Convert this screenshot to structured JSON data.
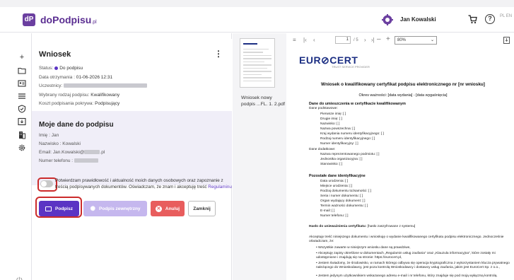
{
  "app": {
    "logo_mark": "dP",
    "logo_name": "doPodpisu",
    "logo_suffix": ".pl",
    "user_name": "Jan Kowalski",
    "lang": "PL EN"
  },
  "sidebar": {
    "icons": [
      "plus-icon",
      "folder-icon",
      "id-card-icon",
      "list-icon",
      "shield-icon",
      "inbox-icon",
      "building-icon",
      "gear-icon"
    ],
    "power_icon": "power-icon"
  },
  "request": {
    "title": "Wniosek",
    "status_label": "Status:",
    "status_value": "Do podpisu",
    "received_label": "Data otrzymania :",
    "received_value": "01-06-2026 12:31",
    "participants_label": "Uczestnicy:",
    "signature_type_label": "Wybrany rodzaj podpisu:",
    "signature_type_value": "Kwalifikowany",
    "cost_label": "Koszt podpisania pokrywa:",
    "cost_value": "Podpisujący"
  },
  "my_data": {
    "title": "Moje dane do podpisu",
    "first_name_label": "Imię :",
    "first_name_value": "Jan",
    "last_name_label": "Nazwisko :",
    "last_name_value": "Kowalski",
    "email_label": "Email:",
    "email_value_start": "Jan.Kowalski@",
    "email_value_end": ".pl",
    "phone_label": "Numer telefonu :"
  },
  "consent": {
    "text": "Potwierdzam prawidłowość i aktualność moich danych osobowych oraz zapoznanie z treścią podpisywanych dokumentów. Oświadczam, że znam i akceptuję treść",
    "link": "Regulaminu"
  },
  "actions": {
    "sign": "Podpisz",
    "external": "Podpis zewnętrzny",
    "cancel": "Anuluj",
    "close": "Zamknij"
  },
  "thumbnail": {
    "label": "Wniosek nowy podpis ...FL. 1. 2.pdf"
  },
  "viewer": {
    "page_current": "1",
    "page_total": "/ 5",
    "zoom": "80%"
  },
  "document": {
    "logo": "EUR⊘CERT",
    "logo_tag": "TRUST SERVICE PROVIDER",
    "title": "Wniosek o kwalifikowany certyfikat podpisu elektronicznego nr [nr wniosku]",
    "subtitle": "Okres ważności:  [data wydania]   -   [data wygaśnięcia]",
    "section1": "Dane do umieszczenia w certyfikacie kwalifikowanym",
    "basic_label": "Dane podstawowe:",
    "basic_fields": [
      "Pierwsze imię: [ ]",
      "Drugie imię: [ ]",
      "Nazwisko: [ ]",
      "Nazwa powszechna: [ ]",
      "Kraj wydania numeru identyfikacyjnego: [ ]",
      "Rodzaj numeru identyfikacyjnego: [ ]",
      "Numer identyfikacyjny: [ ]"
    ],
    "extra_label": "Dane dodatkowe:",
    "extra_fields": [
      "Nazwa reprezentowanego podmiotu: [ ]",
      "Jednostka organizacyjna: [ ]",
      "Stanowisko: [ ]"
    ],
    "section2": "Pozostałe dane identyfikacyjne",
    "other_fields": [
      "Data urodzenia: [ ]",
      "Miejsce urodzenia: [ ]",
      "Rodzaj dokumentu tożsamości: [ ]",
      "Seria i numer dokumentu: [ ]",
      "Organ wydający dokument: [ ]",
      "Termin ważności dokumentu: [ ]",
      "E-mail: [ ]",
      "Numer telefonu: [ ]"
    ],
    "section3": "Hasło do unieważnienia certyfikatu:",
    "section3_value": "[hasło zaszyfrowane z systemu]",
    "para1": "Akceptuję treść niniejszego dokumentu i wnioskuję o wydanie kwalifikowanego certyfikatu podpisu elektronicznego. Jednocześnie oświadczam, że:",
    "bullets": [
      "Wszystkie zawarte w niniejszym wniosku dane są prawdziwe,",
      "Akceptuję zapisy określone w dokumentach „Regulamin usług zaufania” oraz „Klauzula informacyjna”, które zostały mi udostępnione i znajdują się na stronie: https://eurocert.pl,",
      "Jestem świadomy, że środowisko, w ramach którego odbywa się operacja kryptograficzna z wykorzystaniem klucza prywatnego należącego do Wnioskodawcy, jest poza kontrolą Wnioskodawcy i dostawcy usług zaufania, jakim jest EuroCert Sp. z o.o.,",
      "Jestem jedynym użytkownikiem wskazanego adresu e-mail i nr telefonu, który znajduje się pod moją wyłączną kontrolą."
    ]
  }
}
